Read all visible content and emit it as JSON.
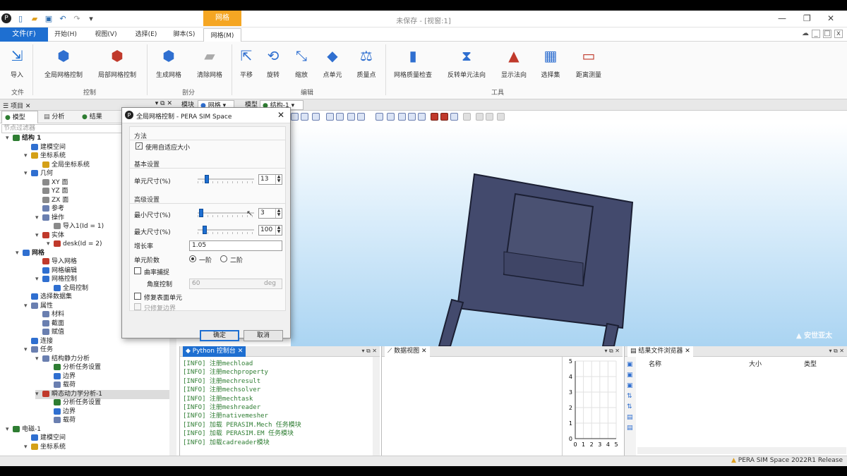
{
  "app": {
    "window_title": "未保存 - [视窗:1]",
    "context_tab": "网格",
    "status_text": "PERA SIM Space 2022R1 Release",
    "watermark": "安世亚太"
  },
  "menu": {
    "file": "文件(F)",
    "tabs": [
      "开始(H)",
      "视图(V)",
      "选择(E)",
      "脚本(S)",
      "网格(M)"
    ]
  },
  "ribbon": {
    "buttons": [
      "导入",
      "全局网格控制",
      "局部网格控制",
      "生成网格",
      "清除网格",
      "平移",
      "旋转",
      "缩放",
      "点单元",
      "质量点",
      "网格质量检查",
      "反转单元法向",
      "显示法向",
      "选择集",
      "距离测量"
    ],
    "groups": [
      "文件",
      "控制",
      "剖分",
      "编辑",
      "工具"
    ]
  },
  "left_panel": {
    "title": "项目",
    "tabs": [
      "模型",
      "分析",
      "结果"
    ],
    "filter_placeholder": "节点过滤器",
    "tree": [
      {
        "label": "结构 1",
        "bold": true
      },
      {
        "label": "建模空间"
      },
      {
        "label": "坐标系统"
      },
      {
        "label": "全局坐标系统"
      },
      {
        "label": "几何"
      },
      {
        "label": "XY 面"
      },
      {
        "label": "YZ 面"
      },
      {
        "label": "ZX 面"
      },
      {
        "label": "参考"
      },
      {
        "label": "操作"
      },
      {
        "label": "导入1(Id = 1)"
      },
      {
        "label": "实体"
      },
      {
        "label": "desk(Id = 2)"
      },
      {
        "label": "网格",
        "bold": true
      },
      {
        "label": "导入网格"
      },
      {
        "label": "网格编辑"
      },
      {
        "label": "网格控制"
      },
      {
        "label": "全局控制"
      },
      {
        "label": "选择数据集"
      },
      {
        "label": "属性"
      },
      {
        "label": "材料"
      },
      {
        "label": "截面"
      },
      {
        "label": "赋值"
      },
      {
        "label": "连接"
      },
      {
        "label": "任务"
      },
      {
        "label": "结构静力分析"
      },
      {
        "label": "分析任务设置"
      },
      {
        "label": "边界"
      },
      {
        "label": "载荷"
      },
      {
        "label": "瞬态动力学分析-1"
      },
      {
        "label": "分析任务设置"
      },
      {
        "label": "边界"
      },
      {
        "label": "载荷"
      },
      {
        "label": "电磁-1"
      },
      {
        "label": "建模空间"
      },
      {
        "label": "坐标系统"
      }
    ]
  },
  "view_tabs": [
    "模块",
    "网格",
    "模型",
    "结构-1"
  ],
  "dialog": {
    "title": "全局网格控制 - PERA SIM Space",
    "method_header": "方法",
    "adaptive_label": "使用自适应大小",
    "basic_header": "基本设置",
    "elem_size_label": "单元尺寸(%)",
    "elem_size_value": "13",
    "elem_size_slider": 0.13,
    "advanced_header": "高级设置",
    "min_size_label": "最小尺寸(%)",
    "min_size_value": "3",
    "min_size_slider": 0.03,
    "max_size_label": "最大尺寸(%)",
    "max_size_value": "100",
    "max_size_slider": 0.1,
    "growth_label": "增长率",
    "growth_value": "1.05",
    "order_label": "单元阶数",
    "order_first": "一阶",
    "order_second": "二阶",
    "curvature_label": "曲率捕捉",
    "angle_label": "角度控制",
    "angle_value": "60",
    "angle_unit": "deg",
    "repair_label": "修复表面单元",
    "repair_only_label": "只修复边界",
    "ok_label": "确定",
    "cancel_label": "取消"
  },
  "console": {
    "title": "Python 控制台",
    "lines": [
      "[INFO] 注册mechload",
      "[INFO] 注册mechproperty",
      "[INFO] 注册mechresult",
      "[INFO] 注册mechsolver",
      "[INFO] 注册mechtask",
      "[INFO] 注册meshreader",
      "[INFO] 注册nativemesher",
      "[INFO] 加载 PERASIM.Mech 任务模块",
      "[INFO] 加载 PERASIM.EM 任务模块",
      "[INFO] 加载cadreader模块"
    ]
  },
  "data_view": {
    "title": "数据视图",
    "y_ticks": [
      "5",
      "4",
      "3",
      "2",
      "1",
      "0"
    ],
    "x_ticks": [
      "0",
      "1",
      "2",
      "3",
      "4",
      "5"
    ]
  },
  "file_browser": {
    "title": "结果文件浏览器",
    "columns": [
      "名称",
      "大小",
      "类型"
    ]
  },
  "colors": {
    "accent": "#1e6fd1",
    "context_tab": "#f5a623",
    "model": "#434a6d",
    "model_edge": "#1b1f33"
  }
}
